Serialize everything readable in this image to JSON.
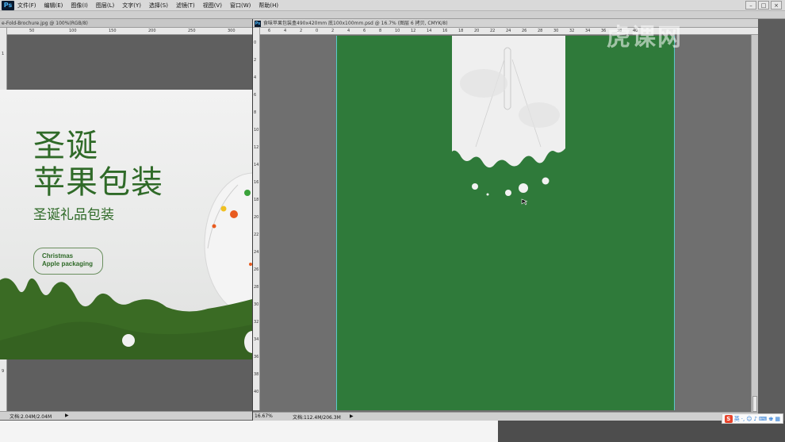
{
  "app": {
    "logo": "Ps",
    "menu": [
      "文件(F)",
      "编辑(E)",
      "图像(I)",
      "图层(L)",
      "文字(Y)",
      "选择(S)",
      "滤镜(T)",
      "视图(V)",
      "窗口(W)",
      "帮助(H)"
    ],
    "window_controls": [
      "–",
      "□",
      "×"
    ]
  },
  "left_document": {
    "tab_title": "e-Fold-Brochure.jpg @ 100%(RGB/8)",
    "ruler_h_numbers": [
      "50",
      "100",
      "150",
      "200",
      "250",
      "300"
    ],
    "ruler_v_numbers": [
      "1",
      "2",
      "3",
      "4",
      "5",
      "6",
      "7",
      "8",
      "9"
    ],
    "status_text": "文档:2.04M/2.04M",
    "artwork": {
      "title_line1": "圣诞",
      "title_line2": "苹果包装",
      "subtitle": "圣诞礼品包装",
      "pill_line1": "Christmas",
      "pill_line2": "Apple packaging"
    }
  },
  "right_document": {
    "tab_title": "食味苹果包装盒490x420mm 底100x100mm.psd @ 16.7% (图层 6 拷贝, CMYK/8)",
    "ruler_h_numbers": [
      "6",
      "4",
      "2",
      "0",
      "2",
      "4",
      "6",
      "8",
      "10",
      "12",
      "14",
      "16",
      "18",
      "20",
      "22",
      "24",
      "26",
      "28",
      "30",
      "32",
      "34",
      "36",
      "38",
      "40"
    ],
    "ruler_v_numbers": [
      "0",
      "2",
      "4",
      "6",
      "8",
      "10",
      "12",
      "14",
      "16",
      "18",
      "20",
      "22",
      "24",
      "26",
      "28",
      "30",
      "32",
      "34",
      "36",
      "38",
      "40"
    ],
    "zoom": "16.67%",
    "status_text": "文档:112.4M/206.3M"
  },
  "watermark": "虎课网",
  "tray": {
    "ime_logo": "S",
    "ime_label": "英"
  },
  "colors": {
    "canvas_green": "#2f7a3a",
    "art_green": "#2f6a28",
    "drip_white": "#efefef"
  }
}
